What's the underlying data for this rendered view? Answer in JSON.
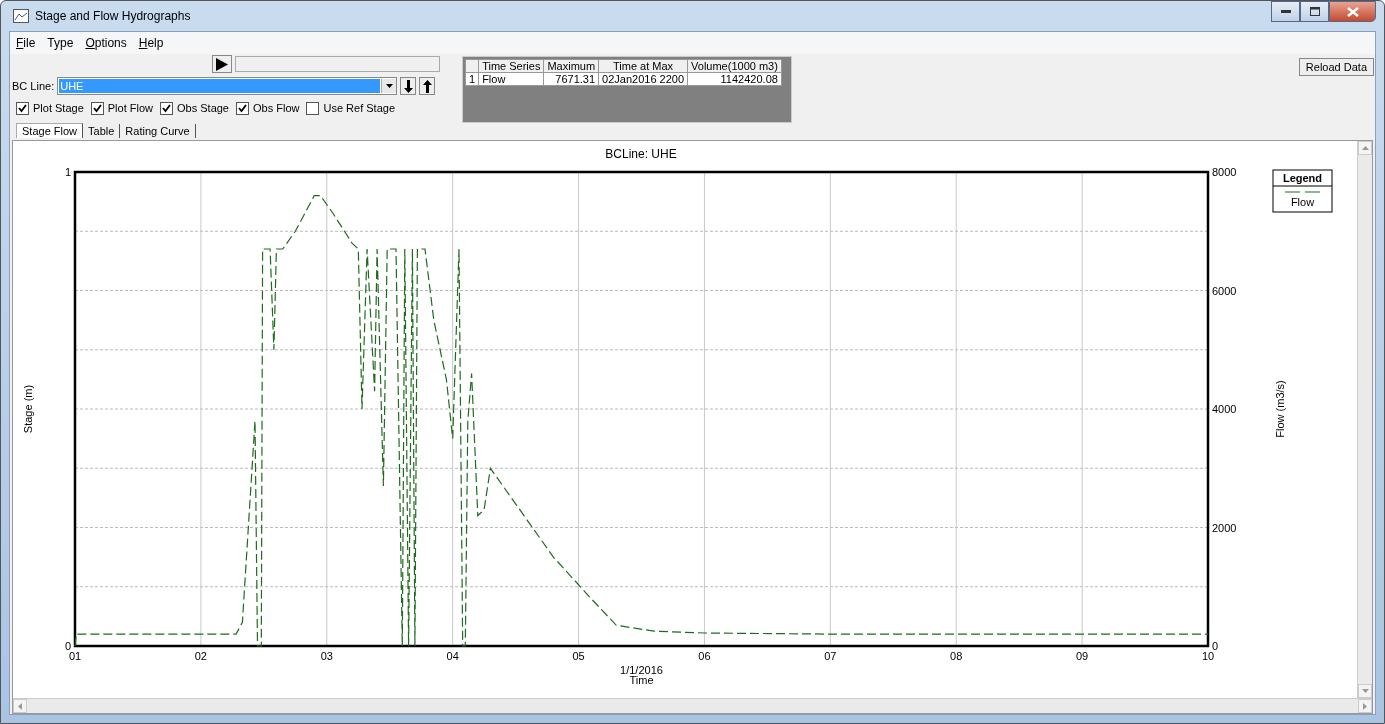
{
  "window": {
    "title": "Stage and Flow Hydrographs"
  },
  "menu": [
    {
      "label": "File",
      "access_key": true
    },
    {
      "label": "Type",
      "access_key": false
    },
    {
      "label": "Options",
      "access_key": true
    },
    {
      "label": "Help",
      "access_key": true
    }
  ],
  "bc_line": {
    "label": "BC Line:",
    "value": "UHE"
  },
  "checkboxes": [
    {
      "label": "Plot Stage",
      "checked": true
    },
    {
      "label": "Plot Flow",
      "checked": true
    },
    {
      "label": "Obs Stage",
      "checked": true
    },
    {
      "label": "Obs Flow",
      "checked": true
    },
    {
      "label": "Use Ref Stage",
      "checked": false
    }
  ],
  "tabs": [
    {
      "label": "Stage Flow",
      "selected": true
    },
    {
      "label": "Table",
      "selected": false
    },
    {
      "label": "Rating Curve",
      "selected": false
    }
  ],
  "summary_table": {
    "columns": [
      "",
      "Time Series",
      "Maximum",
      "Time at Max",
      "Volume(1000 m3)"
    ],
    "rows": [
      [
        "1",
        "Flow",
        "7671.31",
        "02Jan2016  2200",
        "1142420.08"
      ]
    ]
  },
  "reload_button": "Reload Data",
  "chart": {
    "stage_axis": {
      "label": "Stage (m)",
      "ticks": [
        "1",
        "0"
      ]
    },
    "date_label": "1/1/2016",
    "legend_title": "Legend",
    "chart_data": {
      "type": "line",
      "grid": true,
      "title": "BCLine: UHE",
      "xlabel": "Time",
      "ylabel": "Flow (m3/s)",
      "xlim": [
        1,
        10
      ],
      "ylim": [
        0,
        8000
      ],
      "xticks": [
        {
          "value": 1,
          "label": "01"
        },
        {
          "value": 2,
          "label": "02"
        },
        {
          "value": 3,
          "label": "03"
        },
        {
          "value": 4,
          "label": "04"
        },
        {
          "value": 5,
          "label": "05"
        },
        {
          "value": 6,
          "label": "06"
        },
        {
          "value": 7,
          "label": "07"
        },
        {
          "value": 8,
          "label": "08"
        },
        {
          "value": 9,
          "label": "09"
        },
        {
          "value": 10,
          "label": "10"
        }
      ],
      "yticks": [
        0,
        2000,
        4000,
        6000,
        8000
      ],
      "x": [
        1,
        1.01,
        2.28,
        2.33,
        2.43,
        2.45,
        2.48,
        2.49,
        2.55,
        2.58,
        2.6,
        2.65,
        2.75,
        2.9,
        2.95,
        3.05,
        3.2,
        3.25,
        3.28,
        3.32,
        3.38,
        3.4,
        3.45,
        3.48,
        3.55,
        3.6,
        3.62,
        3.65,
        3.68,
        3.7,
        3.72,
        3.78,
        3.85,
        3.95,
        4.0,
        4.05,
        4.08,
        4.1,
        4.12,
        4.15,
        4.2,
        4.25,
        4.3,
        4.5,
        4.8,
        5.1,
        5.3,
        5.6,
        6.0,
        7.0,
        10.0
      ],
      "series": [
        {
          "name": "Flow",
          "color": "#1e6b1e",
          "line_style": "dashed",
          "values": [
            0,
            200,
            200,
            400,
            3800,
            0,
            0,
            6700,
            6700,
            5000,
            6700,
            6700,
            7000,
            7600,
            7600,
            7300,
            6800,
            6700,
            4000,
            6700,
            4300,
            6700,
            2700,
            6700,
            6700,
            0,
            6700,
            0,
            6700,
            0,
            6700,
            6700,
            5500,
            4500,
            3500,
            6700,
            0,
            0,
            3800,
            4600,
            2200,
            2300,
            3000,
            2400,
            1500,
            800,
            350,
            250,
            220,
            200,
            200
          ]
        }
      ]
    }
  }
}
